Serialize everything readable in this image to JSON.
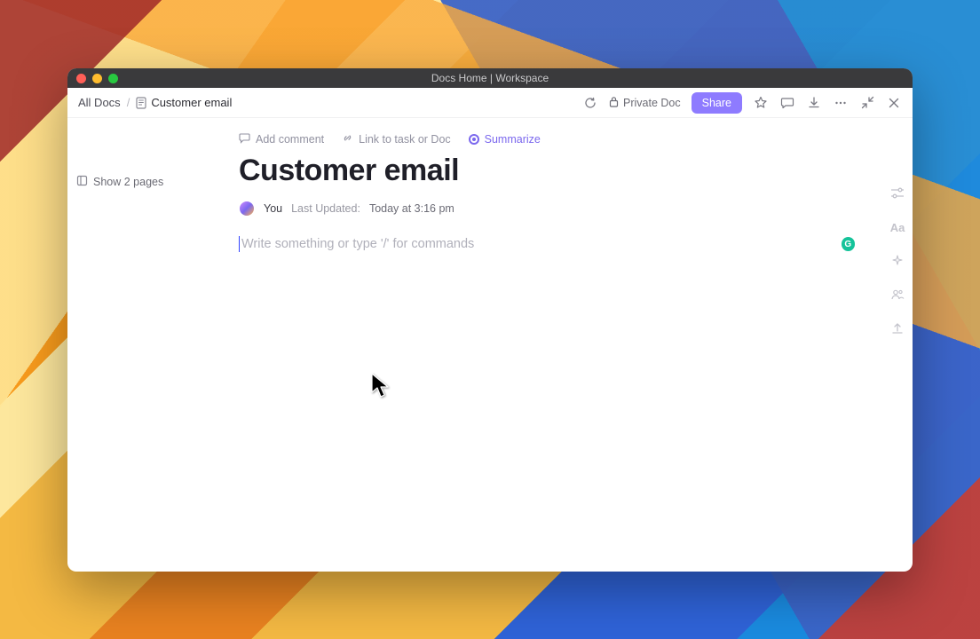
{
  "window": {
    "title": "Docs Home | Workspace"
  },
  "breadcrumb": {
    "root": "All Docs",
    "current": "Customer email"
  },
  "topbar": {
    "private_label": "Private Doc",
    "share_label": "Share"
  },
  "sidebar": {
    "show_pages_label": "Show 2 pages"
  },
  "quick_actions": {
    "add_comment": "Add comment",
    "link_task": "Link to task or Doc",
    "summarize": "Summarize"
  },
  "doc": {
    "title": "Customer email",
    "author": "You",
    "last_updated_label": "Last Updated:",
    "last_updated_value": "Today at 3:16 pm",
    "editor_placeholder": "Write something or type '/' for commands"
  },
  "grammar_badge": "G"
}
